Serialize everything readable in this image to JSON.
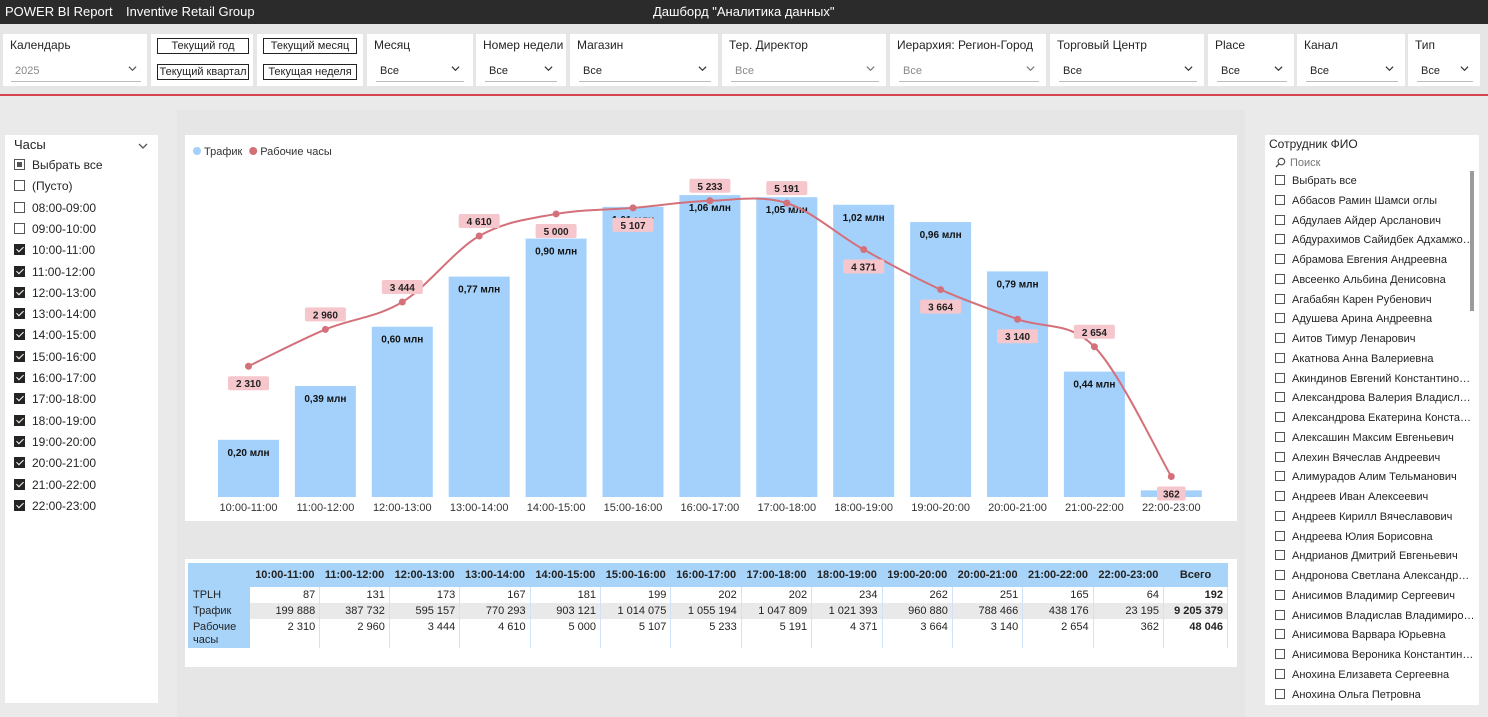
{
  "header": {
    "brand": "POWER BI Report",
    "company": "Inventive Retail Group",
    "title": "Дашборд \"Аналитика данных\""
  },
  "filters": {
    "calendar": {
      "label": "Календарь",
      "value": "2025"
    },
    "buttons": [
      "Текущий год",
      "Текущий месяц",
      "Текущий квартал",
      "Текущая неделя"
    ],
    "month": {
      "label": "Месяц",
      "value": "Все"
    },
    "week": {
      "label": "Номер недели",
      "value": "Все"
    },
    "store": {
      "label": "Магазин",
      "value": "Все"
    },
    "director": {
      "label": "Тер. Директор",
      "value": "Все"
    },
    "hierarchy": {
      "label": "Иерархия: Регион-Город",
      "value": "Все"
    },
    "mall": {
      "label": "Торговый Центр",
      "value": "Все"
    },
    "place": {
      "label": "Place",
      "value": "Все"
    },
    "channel": {
      "label": "Канал",
      "value": "Все"
    },
    "type": {
      "label": "Тип",
      "value": "Все"
    }
  },
  "hours_slicer": {
    "title": "Часы",
    "items": [
      {
        "label": "Выбрать все",
        "state": "partial"
      },
      {
        "label": "(Пусто)",
        "state": "off"
      },
      {
        "label": "08:00-09:00",
        "state": "off"
      },
      {
        "label": "09:00-10:00",
        "state": "off"
      },
      {
        "label": "10:00-11:00",
        "state": "on"
      },
      {
        "label": "11:00-12:00",
        "state": "on"
      },
      {
        "label": "12:00-13:00",
        "state": "on"
      },
      {
        "label": "13:00-14:00",
        "state": "on"
      },
      {
        "label": "14:00-15:00",
        "state": "on"
      },
      {
        "label": "15:00-16:00",
        "state": "on"
      },
      {
        "label": "16:00-17:00",
        "state": "on"
      },
      {
        "label": "17:00-18:00",
        "state": "on"
      },
      {
        "label": "18:00-19:00",
        "state": "on"
      },
      {
        "label": "19:00-20:00",
        "state": "on"
      },
      {
        "label": "20:00-21:00",
        "state": "on"
      },
      {
        "label": "21:00-22:00",
        "state": "on"
      },
      {
        "label": "22:00-23:00",
        "state": "on"
      }
    ]
  },
  "chart_data": {
    "type": "bar",
    "legend": [
      {
        "name": "Трафик",
        "color": "#a3d1fb"
      },
      {
        "name": "Рабочие часы",
        "color": "#d4707a"
      }
    ],
    "legend_position": "top-left",
    "categories": [
      "10:00-11:00",
      "11:00-12:00",
      "12:00-13:00",
      "13:00-14:00",
      "14:00-15:00",
      "15:00-16:00",
      "16:00-17:00",
      "17:00-18:00",
      "18:00-19:00",
      "19:00-20:00",
      "20:00-21:00",
      "21:00-22:00",
      "22:00-23:00"
    ],
    "series": [
      {
        "name": "Трафик",
        "type": "bar",
        "color": "#a3d1fb",
        "values": [
          199888,
          387732,
          595157,
          770293,
          903121,
          1014075,
          1055194,
          1047809,
          1021393,
          960880,
          788466,
          438176,
          23195
        ],
        "labels": [
          "0,20 млн",
          "0,39 млн",
          "0,60 млн",
          "0,77 млн",
          "0,90 млн",
          "1,01 млн",
          "1,06 млн",
          "1,05 млн",
          "1,02 млн",
          "0,96 млн",
          "0,79 млн",
          "0,44 млн",
          ""
        ]
      },
      {
        "name": "Рабочие часы",
        "type": "line",
        "color": "#d4707a",
        "values": [
          2310,
          2960,
          3444,
          4610,
          5000,
          5107,
          5233,
          5191,
          4371,
          3664,
          3140,
          2654,
          362
        ],
        "labels": [
          "2 310",
          "2 960",
          "3 444",
          "4 610",
          "5 000",
          "5 107",
          "5 233",
          "5 191",
          "4 371",
          "3 664",
          "3 140",
          "2 654",
          "362"
        ]
      }
    ],
    "grid": false
  },
  "table": {
    "headers": [
      "10:00-11:00",
      "11:00-12:00",
      "12:00-13:00",
      "13:00-14:00",
      "14:00-15:00",
      "15:00-16:00",
      "16:00-17:00",
      "17:00-18:00",
      "18:00-19:00",
      "19:00-20:00",
      "20:00-21:00",
      "21:00-22:00",
      "22:00-23:00",
      "Всего"
    ],
    "rows": [
      {
        "label": "TPLH",
        "cells": [
          "87",
          "131",
          "173",
          "167",
          "181",
          "199",
          "202",
          "202",
          "234",
          "262",
          "251",
          "165",
          "64",
          "192"
        ]
      },
      {
        "label": "Трафик",
        "cells": [
          "199 888",
          "387 732",
          "595 157",
          "770 293",
          "903 121",
          "1 014 075",
          "1 055 194",
          "1 047 809",
          "1 021 393",
          "960 880",
          "788 466",
          "438 176",
          "23 195",
          "9 205 379"
        ]
      },
      {
        "label": "Рабочие часы",
        "cells": [
          "2 310",
          "2 960",
          "3 444",
          "4 610",
          "5 000",
          "5 107",
          "5 233",
          "5 191",
          "4 371",
          "3 664",
          "3 140",
          "2 654",
          "362",
          "48 046"
        ]
      }
    ]
  },
  "employee_slicer": {
    "title": "Сотрудник ФИО",
    "search_placeholder": "Поиск",
    "items": [
      "Выбрать все",
      "Аббасов Рамин Шамси оглы",
      "Абдулаев Айдер Арсланович",
      "Абдурахимов Сайидбек Адхамжон ...",
      "Абрамова Евгения Андреевна",
      "Авсеенко Альбина Денисовна",
      "Агабабян Карен Рубенович",
      "Адушева Арина Андреевна",
      "Аитов Тимур Ленарович",
      "Акатнова Анна Валериевна",
      "Акиндинов Евгений Константинович",
      "Александрова Валерия Владиславо...",
      "Александрова Екатерина Константи...",
      "Алексашин Максим Евгеньевич",
      "Алехин Вячеслав Андреевич",
      "Алимурадов Алим Тельманович",
      "Андреев Иван Алексеевич",
      "Андреев Кирилл Вячеславович",
      "Андреева Юлия Борисовна",
      "Андрианов Дмитрий Евгеньевич",
      "Андронова Светлана Александровна",
      "Анисимов Владимир Сергеевич",
      "Анисимов Владислав Владимирович",
      "Анисимова Варвара Юрьевна",
      "Анисимова Вероника Константинов...",
      "Анохина Елизавета Сергеевна",
      "Анохина Ольга Петровна"
    ]
  }
}
